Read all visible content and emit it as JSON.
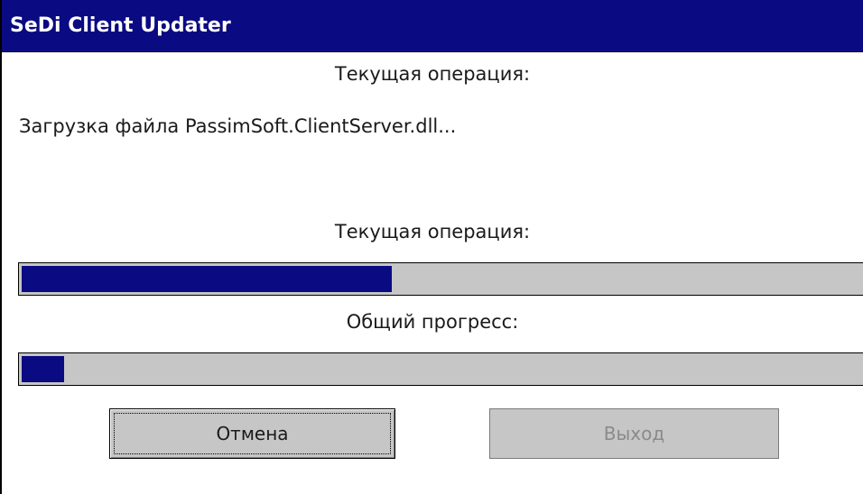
{
  "window": {
    "title": "SeDi Client Updater"
  },
  "current_operation_label": "Текущая операция:",
  "status_text": "Загрузка файла PassimSoft.ClientServer.dll...",
  "file_progress": {
    "label": "Текущая операция:",
    "fraction": 0.44
  },
  "overall_progress": {
    "label": "Общий прогресс:",
    "fraction": 0.05
  },
  "buttons": {
    "cancel_label": "Отмена",
    "exit_label": "Выход",
    "exit_enabled": false
  },
  "colors": {
    "title_bar": "#0a0a82",
    "progress_fill": "#0a0a82",
    "progress_track": "#c6c6c6"
  }
}
